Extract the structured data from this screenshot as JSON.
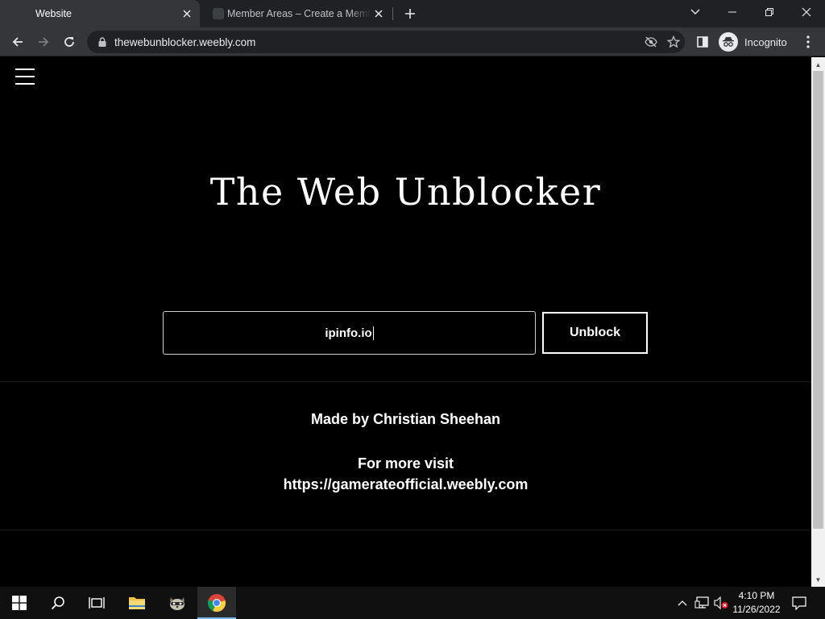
{
  "browser": {
    "tabs": [
      {
        "title": "Website",
        "active": true
      },
      {
        "title": "Member Areas – Create a Member",
        "active": false
      }
    ],
    "address": "thewebunblocker.weebly.com",
    "profile_label": "Incognito"
  },
  "page": {
    "title": "The Web Unblocker",
    "url_input_value": "ipinfo.io",
    "unblock_label": "Unblock",
    "credit": "Made by Christian Sheehan",
    "visit_line1": "For more visit",
    "visit_line2": "https://gamerateofficial.weebly.com"
  },
  "taskbar": {
    "time": "4:10 PM",
    "date": "11/26/2022"
  }
}
